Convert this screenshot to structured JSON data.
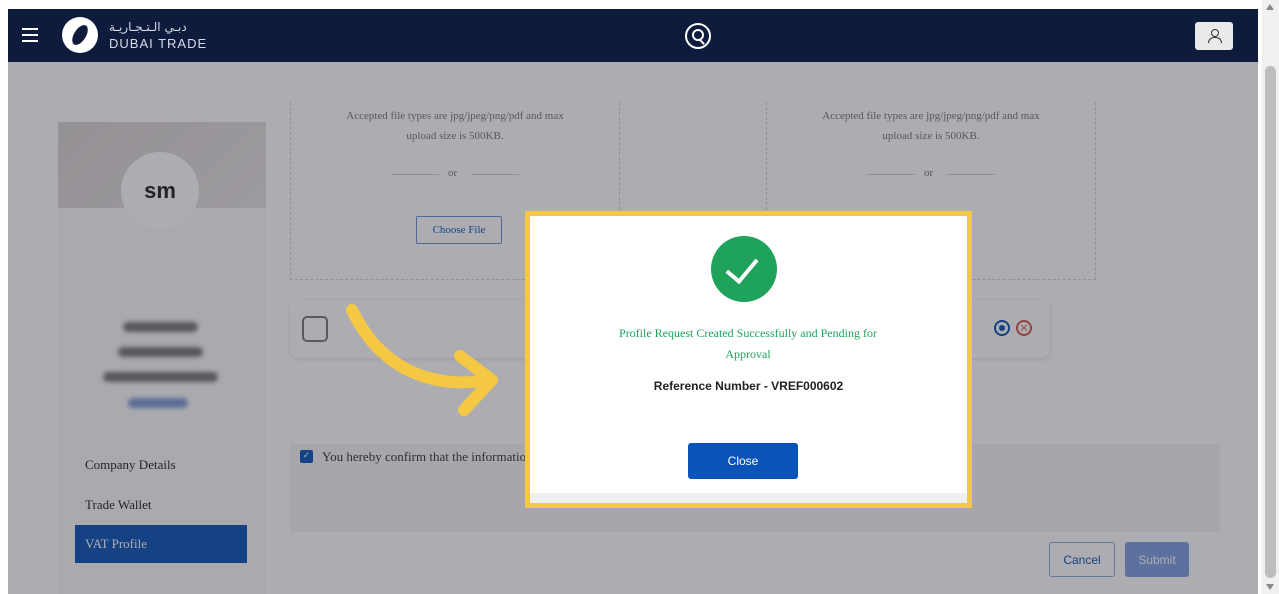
{
  "header": {
    "logo_arabic": "دبـي الـتـجـاريـة",
    "logo_english": "DUBAI TRADE"
  },
  "profile": {
    "initials": "sm"
  },
  "sidebar": {
    "items": [
      {
        "label": "Company Details"
      },
      {
        "label": "Trade Wallet"
      },
      {
        "label": "VAT Profile"
      }
    ]
  },
  "upload": {
    "hint_line1": "Accepted file types are jpg/jpeg/png/pdf and max",
    "hint_line2": "upload size is 500KB.",
    "or_text": "or",
    "choose_file_label": "Choose File"
  },
  "confirm": {
    "text": "You hereby confirm that the information"
  },
  "actions": {
    "cancel_label": "Cancel",
    "submit_label": "Submit"
  },
  "modal": {
    "message": "Profile Request Created Successfully and Pending for Approval",
    "reference": "Reference Number - VREF000602",
    "close_label": "Close"
  },
  "colors": {
    "nav_background": "#0f1b3d",
    "primary": "#0b53b8",
    "success": "#1fa25a",
    "highlight": "#f5c843"
  }
}
